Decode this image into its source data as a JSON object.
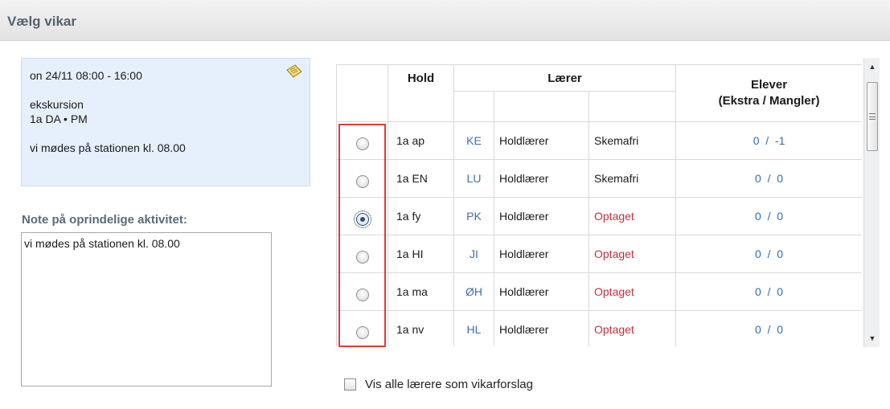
{
  "header": {
    "title": "Vælg vikar"
  },
  "activity": {
    "time": "on 24/11 08:00 - 16:00",
    "type": "ekskursion",
    "class": "1a DA • PM",
    "note": "vi mødes på stationen kl. 08.00",
    "note_icon": "note-icon"
  },
  "note_section": {
    "label": "Note på oprindelige aktivitet:",
    "value": "vi mødes på stationen kl. 08.00"
  },
  "table": {
    "headers": {
      "hold": "Hold",
      "laerer": "Lærer",
      "elever": "Elever",
      "elever_sub": "(Ekstra / Mangler)"
    },
    "rows": [
      {
        "selected": false,
        "hold": "1a ap",
        "initials": "KE",
        "role": "Holdlærer",
        "status": "Skemafri",
        "elever": "0  /  -1"
      },
      {
        "selected": false,
        "hold": "1a EN",
        "initials": "LU",
        "role": "Holdlærer",
        "status": "Skemafri",
        "elever": "0  /  0"
      },
      {
        "selected": true,
        "hold": "1a fy",
        "initials": "PK",
        "role": "Holdlærer",
        "status": "Optaget",
        "elever": "0  /  0"
      },
      {
        "selected": false,
        "hold": "1a HI",
        "initials": "JI",
        "role": "Holdlærer",
        "status": "Optaget",
        "elever": "0  /  0"
      },
      {
        "selected": false,
        "hold": "1a ma",
        "initials": "ØH",
        "role": "Holdlærer",
        "status": "Optaget",
        "elever": "0  /  0"
      },
      {
        "selected": false,
        "hold": "1a nv",
        "initials": "HL",
        "role": "Holdlærer",
        "status": "Optaget",
        "elever": "0  /  0"
      }
    ]
  },
  "options": {
    "show_all_label": "Vis alle lærere som vikarforslag",
    "show_all_checked": false
  },
  "colors": {
    "status_busy": "#c0303d",
    "initials": "#3c71a8",
    "counts": "#2a6fb0",
    "highlight_frame": "#e23b3b"
  }
}
